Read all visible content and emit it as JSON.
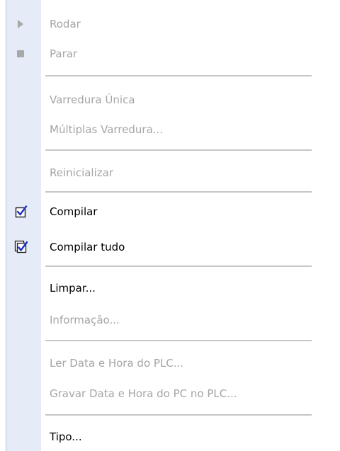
{
  "menu": {
    "items": [
      {
        "label": "Rodar",
        "enabled": false,
        "icon": "run-icon"
      },
      {
        "label": "Parar",
        "enabled": false,
        "icon": "stop-icon"
      },
      {
        "label": "Varredura Única",
        "enabled": false
      },
      {
        "label": "Múltiplas Varredura...",
        "enabled": false
      },
      {
        "label": "Reinicializar",
        "enabled": false
      },
      {
        "label": "Compilar",
        "enabled": true,
        "icon": "compile-icon"
      },
      {
        "label": "Compilar tudo",
        "enabled": true,
        "icon": "compile-all-icon"
      },
      {
        "label": "Limpar...",
        "enabled": true
      },
      {
        "label": "Informação...",
        "enabled": false
      },
      {
        "label": "Ler Data e Hora do PLC...",
        "enabled": false
      },
      {
        "label": "Gravar Data e Hora do PC no PLC...",
        "enabled": false
      },
      {
        "label": "Tipo...",
        "enabled": true
      }
    ]
  },
  "colors": {
    "gutter": "#e5ecf8",
    "disabled_text": "#a5a5a5",
    "enabled_text": "#000000",
    "check_blue": "#1e32c8"
  }
}
